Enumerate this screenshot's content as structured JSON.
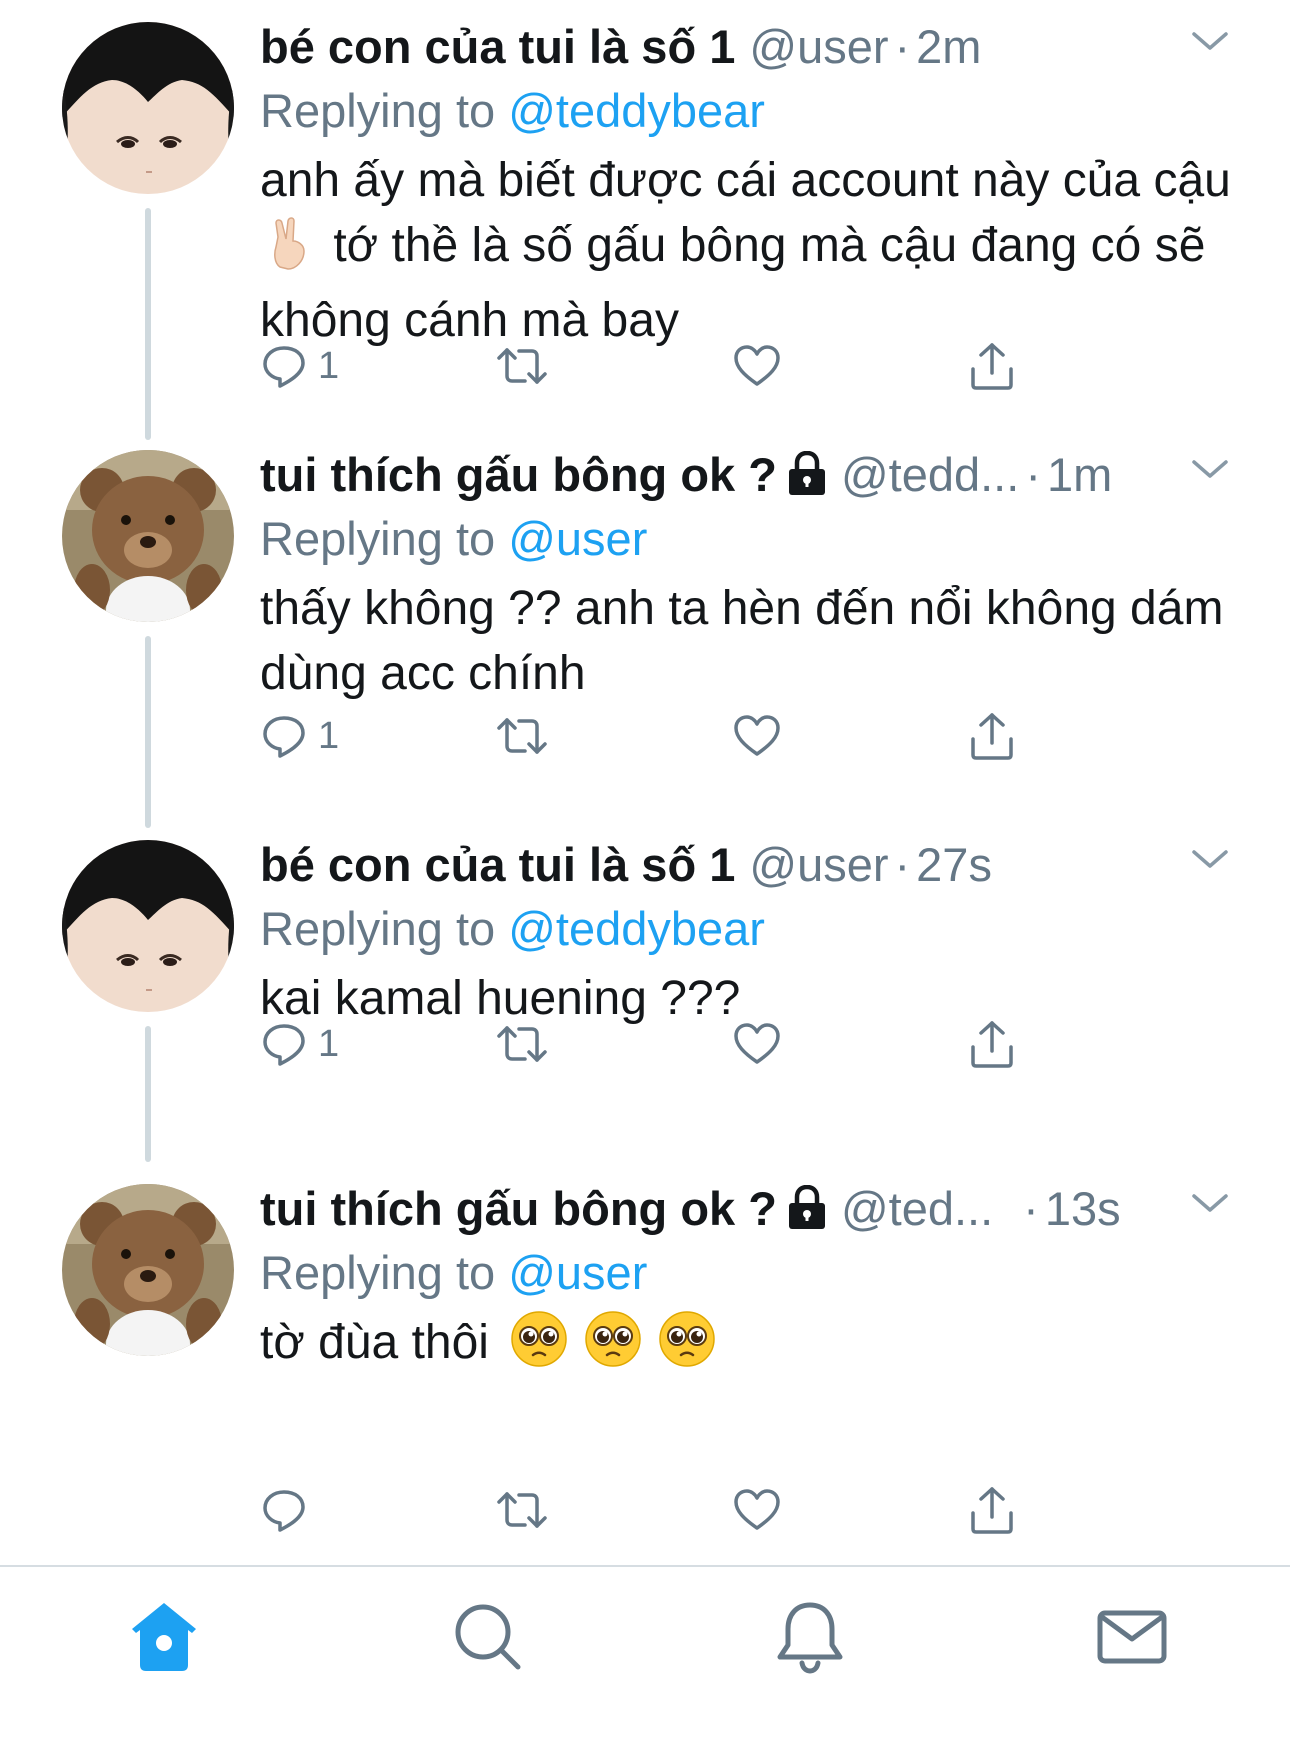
{
  "colors": {
    "accent": "#1da1f2",
    "text": "#14171a",
    "muted": "#657786",
    "thread_line": "#cfd9de",
    "divider": "#d6dde2"
  },
  "tweets": [
    {
      "name": "bé con của tui là số 1",
      "protected": false,
      "handle": "@user",
      "time": "2m",
      "replying_label": "Replying to",
      "replying_to": "@teddybear",
      "text_parts": [
        "anh ấy mà biết được cái account này của cậu",
        "tớ thề là số gấu bông mà cậu đang có sẽ không cánh mà bay"
      ],
      "emoji": [
        "victory-hand"
      ],
      "reply_count": "1"
    },
    {
      "name": "tui thích gấu bông ok ?",
      "protected": true,
      "handle": "@tedd...",
      "time": "1m",
      "replying_label": "Replying to",
      "replying_to": "@user",
      "text": "thấy không ?? anh ta hèn đến nổi không dám dùng acc chính",
      "reply_count": "1"
    },
    {
      "name": "bé con của tui là số 1",
      "protected": false,
      "handle": "@user",
      "time": "27s",
      "replying_label": "Replying to",
      "replying_to": "@teddybear",
      "text": "kai kamal huening ???",
      "reply_count": "1"
    },
    {
      "name": "tui thích gấu bông ok ?",
      "protected": true,
      "handle": "@ted...",
      "time": "13s",
      "replying_label": "Replying to",
      "replying_to": "@user",
      "text": "tờ đùa thôi",
      "emoji": [
        "pleading-face",
        "pleading-face",
        "pleading-face"
      ],
      "reply_count": ""
    }
  ],
  "separator": "·",
  "icons": {
    "reply": "reply-icon",
    "retweet": "retweet-icon",
    "like": "heart-icon",
    "share": "share-icon",
    "more": "chevron-down-icon",
    "lock": "lock-icon"
  },
  "tabbar": {
    "items": [
      "home-icon",
      "search-icon",
      "notifications-icon",
      "messages-icon"
    ],
    "active": "home-icon"
  }
}
